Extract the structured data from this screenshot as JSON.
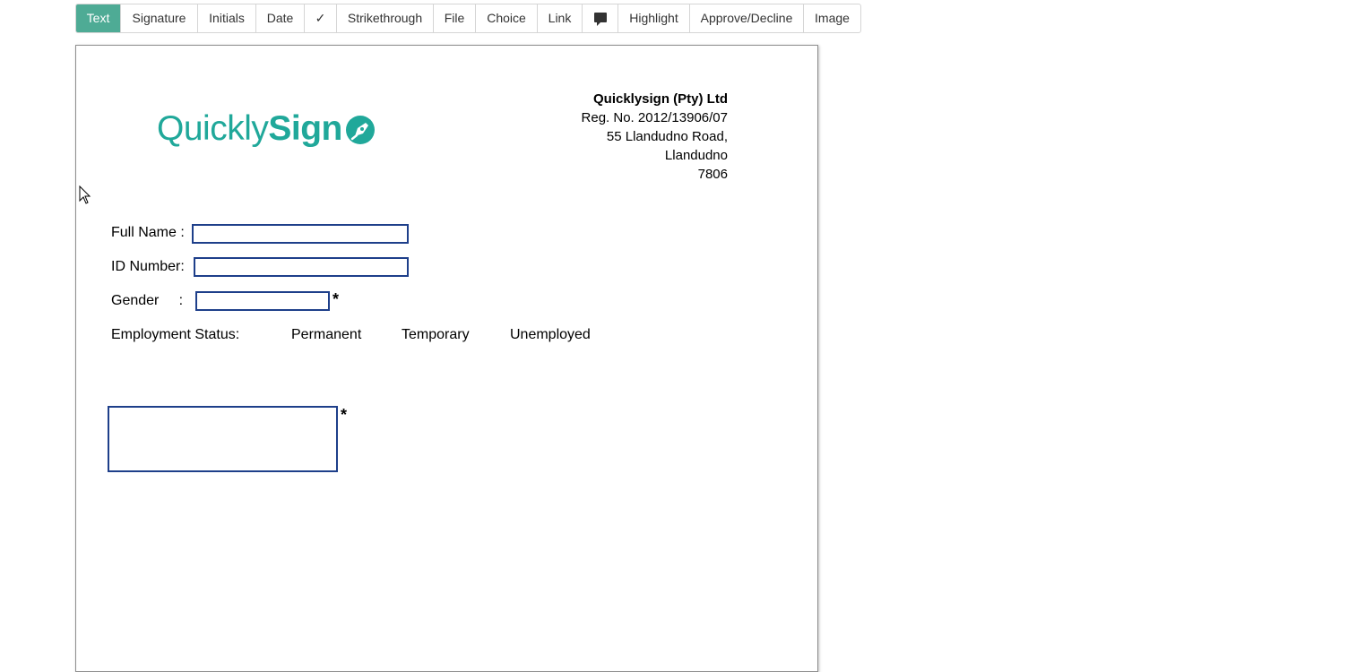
{
  "toolbar": {
    "items": [
      {
        "label": "Text",
        "active": true
      },
      {
        "label": "Signature"
      },
      {
        "label": "Initials"
      },
      {
        "label": "Date"
      },
      {
        "label": "✓"
      },
      {
        "label": "Strikethrough"
      },
      {
        "label": "File"
      },
      {
        "label": "Choice"
      },
      {
        "label": "Link"
      },
      {
        "label": "",
        "icon": "comment-icon"
      },
      {
        "label": "Highlight"
      },
      {
        "label": "Approve/Decline"
      },
      {
        "label": "Image"
      }
    ],
    "active_color": "#4eab95"
  },
  "document": {
    "logo": {
      "light": "Quickly",
      "bold": "Sign",
      "icon": "pen-nib-icon",
      "color": "#20a89a"
    },
    "company": {
      "name": "Quicklysign (Pty) Ltd",
      "reg": "Reg. No. 2012/13906/07",
      "address1": "55 Llandudno Road,",
      "address2": "Llandudno",
      "postal": "7806"
    },
    "form": {
      "full_name_label": "Full Name :",
      "full_name_value": "",
      "id_number_label": "ID Number:",
      "id_number_value": "",
      "gender_label": "Gender     :",
      "gender_value": "",
      "required_mark": "*",
      "employment_label": "Employment Status:",
      "employment_options": [
        "Permanent",
        "Temporary",
        "Unemployed"
      ],
      "signature_box_value": "",
      "field_border_color": "#1e3f8a"
    }
  }
}
